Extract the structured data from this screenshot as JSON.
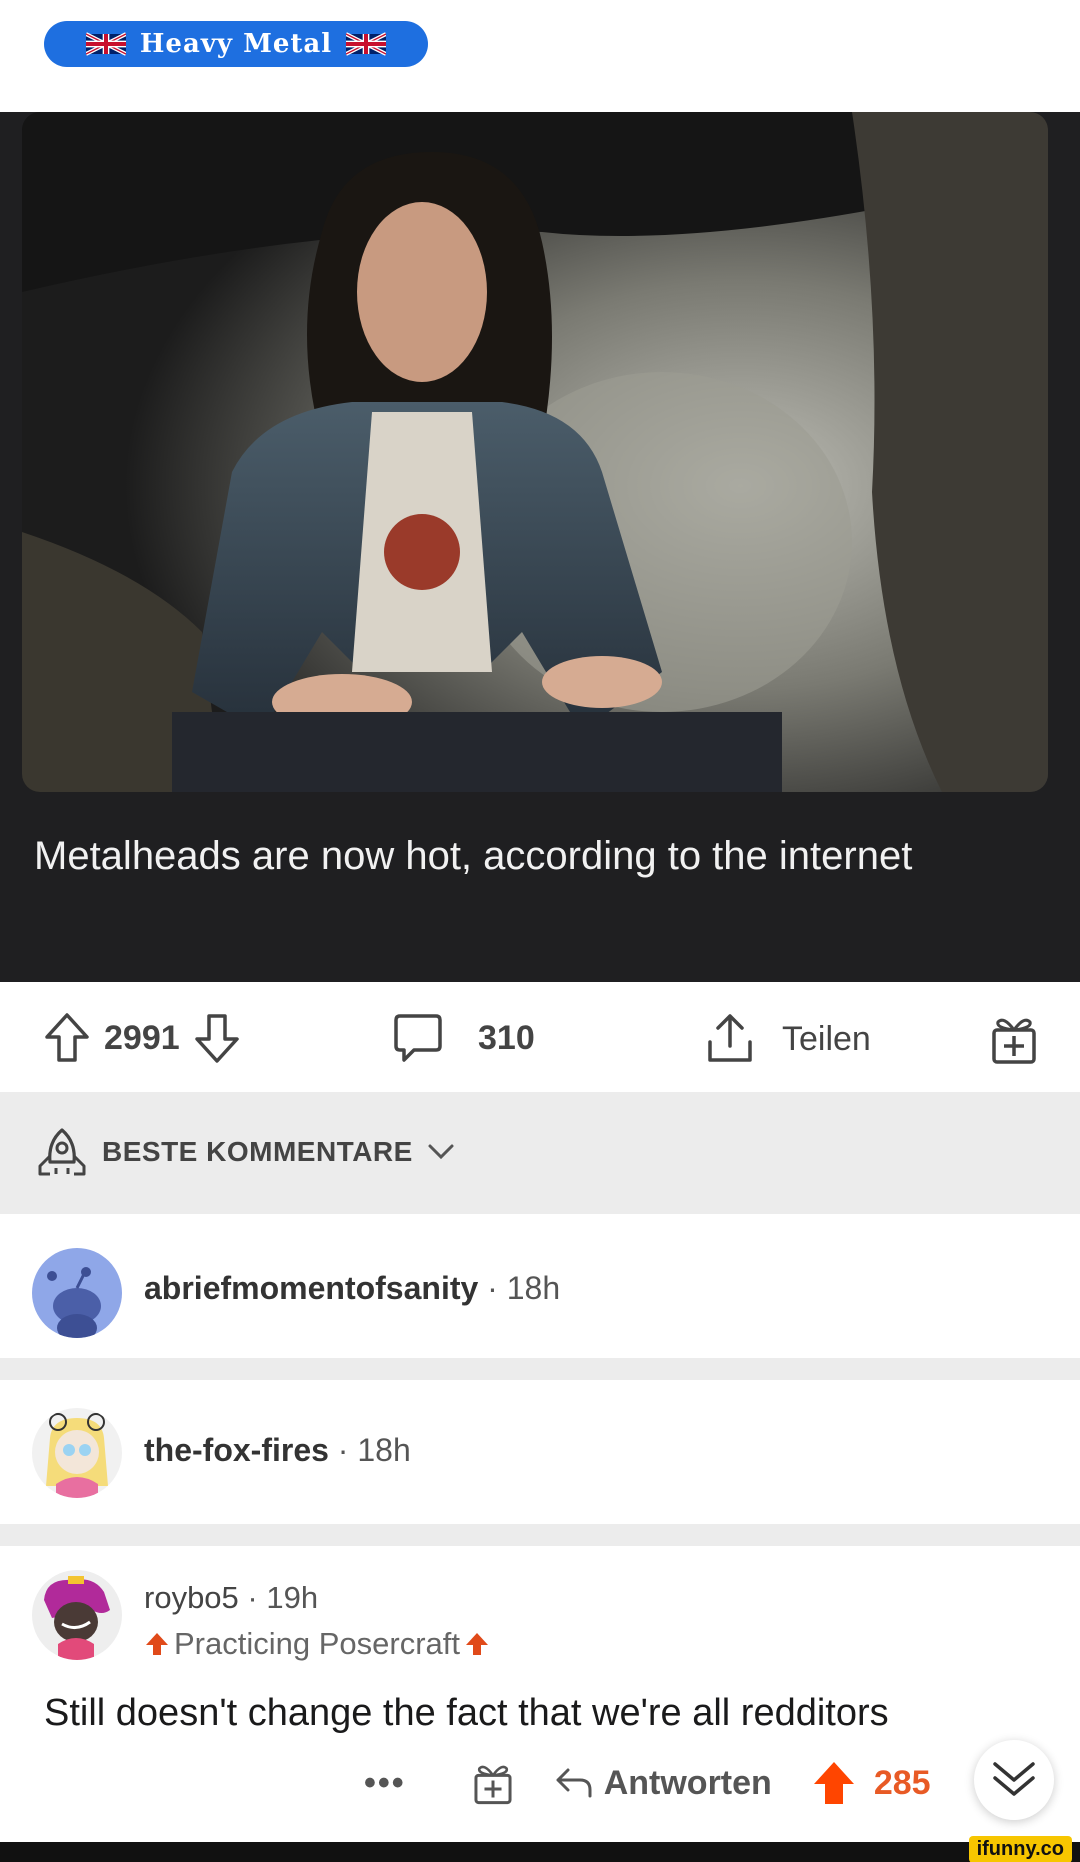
{
  "post": {
    "flair": "Heavy Metal",
    "caption": "Metalheads are now hot, according to the internet"
  },
  "actions": {
    "score": "2991",
    "comments": "310",
    "share_label": "Teilen"
  },
  "sort": {
    "label": "BESTE KOMMENTARE"
  },
  "comments": [
    {
      "user": "abriefmomentofsanity",
      "time": "18h"
    },
    {
      "user": "the-fox-fires",
      "time": "18h"
    },
    {
      "user": "roybo5",
      "time": "19h",
      "flair": "Practicing Posercraft",
      "text": "Still doesn't change the fact that we're all redditors",
      "reply_label": "Antworten",
      "score": "285"
    }
  ],
  "watermark": "ifunny.co",
  "colors": {
    "flair_bg": "#1e6fe0",
    "upvote": "#ff4500",
    "card_bg": "#1f1f21"
  }
}
